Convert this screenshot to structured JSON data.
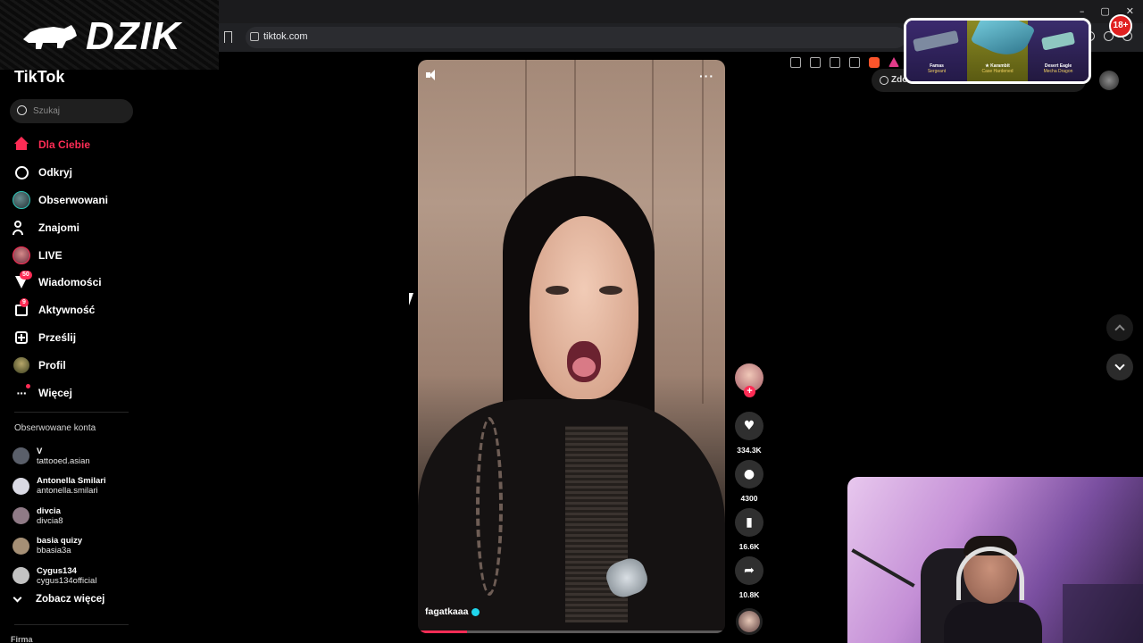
{
  "brand": {
    "logo_text": "DZIK",
    "age_badge": "18+"
  },
  "browser": {
    "url": "tiktok.com",
    "window_controls": [
      "–",
      "▢",
      "✕"
    ]
  },
  "tiktok": {
    "logo_text": "TikTok",
    "search_placeholder": "Szukaj",
    "nav": [
      {
        "label": "Dla Ciebie",
        "icon": "home-icon",
        "active": true
      },
      {
        "label": "Odkryj",
        "icon": "compass-icon"
      },
      {
        "label": "Obserwowani",
        "icon": "following-avatar-icon"
      },
      {
        "label": "Znajomi",
        "icon": "friends-icon"
      },
      {
        "label": "LIVE",
        "icon": "live-icon"
      },
      {
        "label": "Wiadomości",
        "icon": "messages-icon",
        "badge": "50"
      },
      {
        "label": "Aktywność",
        "icon": "activity-icon",
        "badge": "9"
      },
      {
        "label": "Prześlij",
        "icon": "upload-icon"
      },
      {
        "label": "Profil",
        "icon": "profile-icon"
      },
      {
        "label": "Więcej",
        "icon": "more-icon"
      }
    ],
    "followed_title": "Obserwowane konta",
    "accounts": [
      {
        "name": "V",
        "handle": "tattooed.asian",
        "color": "#5a5f6a"
      },
      {
        "name": "Antonella Smilari",
        "handle": "antonella.smilari",
        "color": "#d9d9e3"
      },
      {
        "name": "divcia",
        "handle": "divcia8",
        "color": "#8f7a86"
      },
      {
        "name": "basia quizy",
        "handle": "bbasia3a",
        "color": "#a58f75"
      },
      {
        "name": "Cygus134",
        "handle": "cygus134official",
        "color": "#c2c2c2"
      }
    ],
    "see_more": "Zobacz więcej",
    "footer_section": "Firma",
    "get_coins": "Zdobądź"
  },
  "video": {
    "author": "fagatkaaa",
    "progress": 0.16,
    "stats": {
      "likes": "334.3K",
      "comments": "4300",
      "saves": "16.6K",
      "shares": "10.8K"
    }
  },
  "ad": {
    "items": [
      {
        "name": "Famas",
        "sub": "Sergeant"
      },
      {
        "name": "★ Karambit",
        "sub": "Case Hardened"
      },
      {
        "name": "Desert Eagle",
        "sub": "Mecha Dragon"
      }
    ]
  },
  "colors": {
    "accent": "#fe2c55",
    "verified": "#20d5ec"
  }
}
